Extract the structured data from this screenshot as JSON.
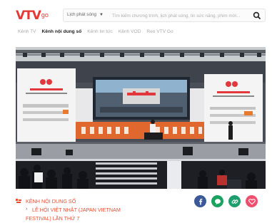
{
  "header": {
    "logo_text": "VTV",
    "logo_suffix": "go",
    "schedule_select": "Lịch phát sóng",
    "search_placeholder": "Tìm kiếm chương trình, lịch phát sóng, tin sức năng, phim mới..."
  },
  "nav": {
    "items": [
      {
        "label": "Kênh TV",
        "active": false
      },
      {
        "label": "Kênh nội dung số",
        "active": true
      },
      {
        "label": "Kênh tin tức",
        "active": false
      },
      {
        "label": "Kênh VOD",
        "active": false
      },
      {
        "label": "Reo VTV Go",
        "active": false
      }
    ]
  },
  "breadcrumb": {
    "channel": "KÊNH NỘI DUNG SỐ",
    "program_line1": "LỄ HỘI VIỆT NHẬT (JAPAN VIETNAM",
    "program_line2": "FESTIVAL) LẦN THỨ 7"
  },
  "share": [
    {
      "name": "facebook",
      "icon": "facebook-icon",
      "color": "#3b5998"
    },
    {
      "name": "line",
      "icon": "line-chat-icon",
      "color": "#1aa260"
    },
    {
      "name": "copy-link",
      "icon": "link-icon",
      "color": "#1e9e6e"
    },
    {
      "name": "favorite",
      "icon": "heart-icon",
      "color": "#f04e6e"
    }
  ],
  "colors": {
    "brand": "#e53935",
    "accent": "#e94b2e"
  }
}
